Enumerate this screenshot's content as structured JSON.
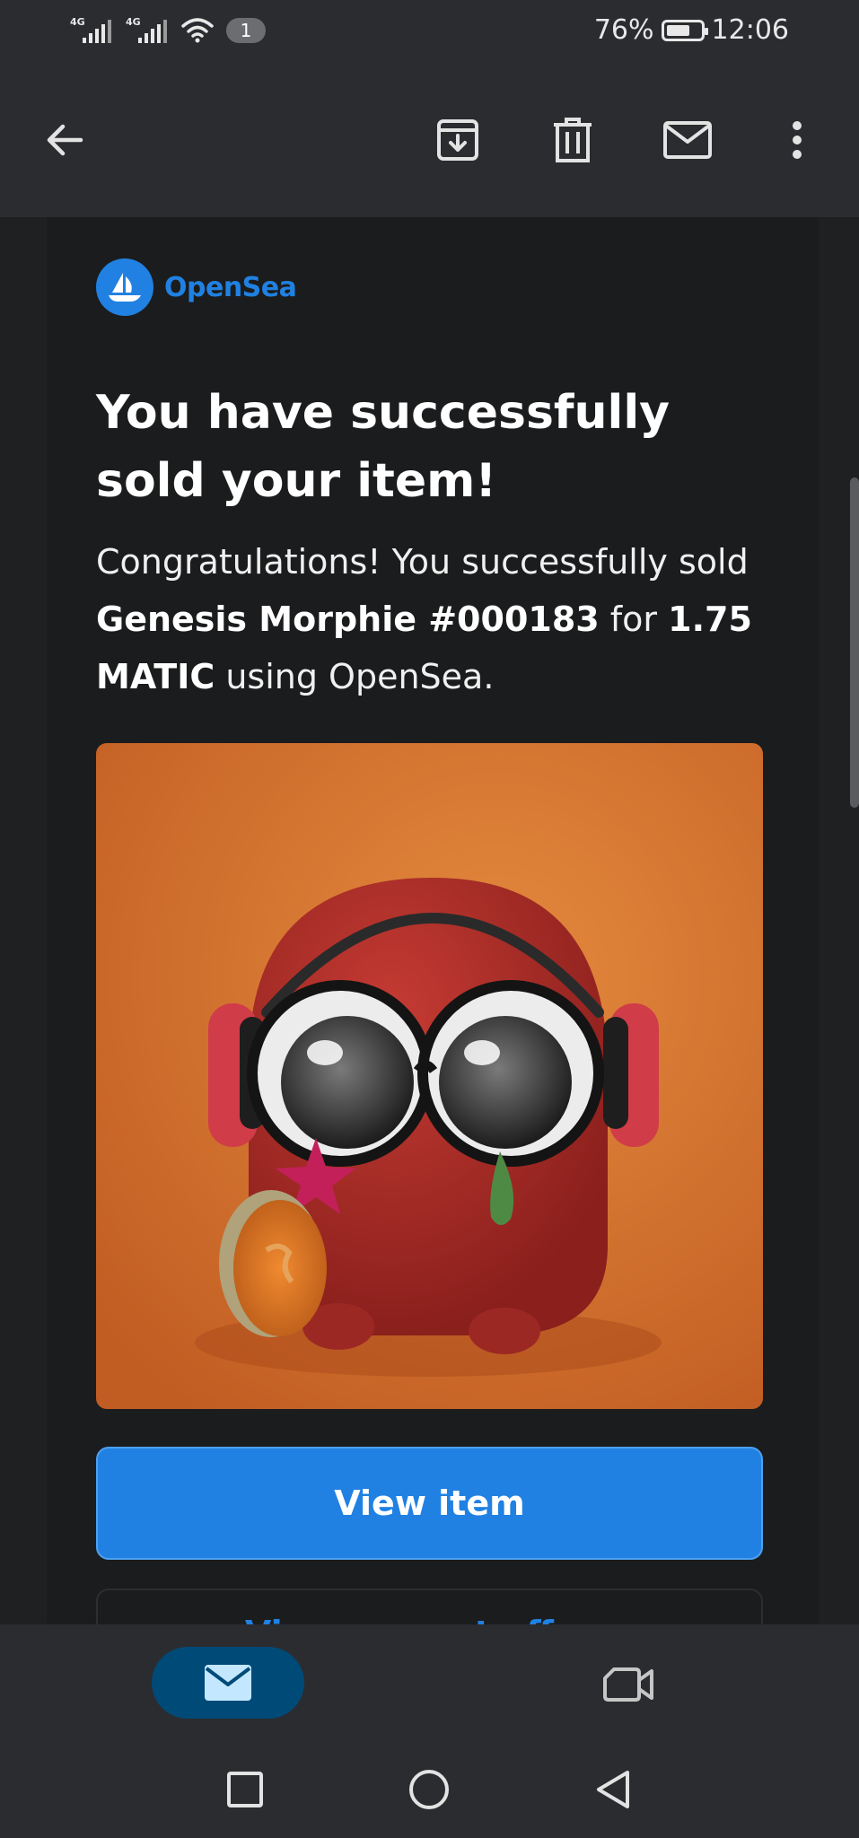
{
  "status_bar": {
    "network_1": "4G",
    "network_2": "4G",
    "notification_count": "1",
    "battery_percent_text": "76%",
    "battery_level": 0.76,
    "time": "12:06"
  },
  "toolbar": {
    "icons": [
      "back-arrow-icon",
      "archive-icon",
      "trash-icon",
      "mark-unread-icon",
      "more-vert-icon"
    ]
  },
  "email": {
    "brand": "OpenSea",
    "headline": "You have successfully sold your item!",
    "body_intro": "Congratulations! You successfully sold ",
    "item_name": "Genesis Morphie #000183",
    "for_word": " for ",
    "price": "1.75 MATIC",
    "body_outro": " using OpenSea.",
    "primary_button": "View item",
    "secondary_button": "View current offers"
  },
  "colors": {
    "accent": "#2081e2",
    "background": "#1b1c1d",
    "chrome": "#2b2c30",
    "nav_selected": "#004a77"
  },
  "bottom_nav": {
    "items": [
      "mail-icon",
      "meet-video-icon"
    ],
    "selected": "mail-icon"
  },
  "system_nav": {
    "items": [
      "recents-square-icon",
      "home-circle-icon",
      "back-triangle-icon"
    ]
  }
}
